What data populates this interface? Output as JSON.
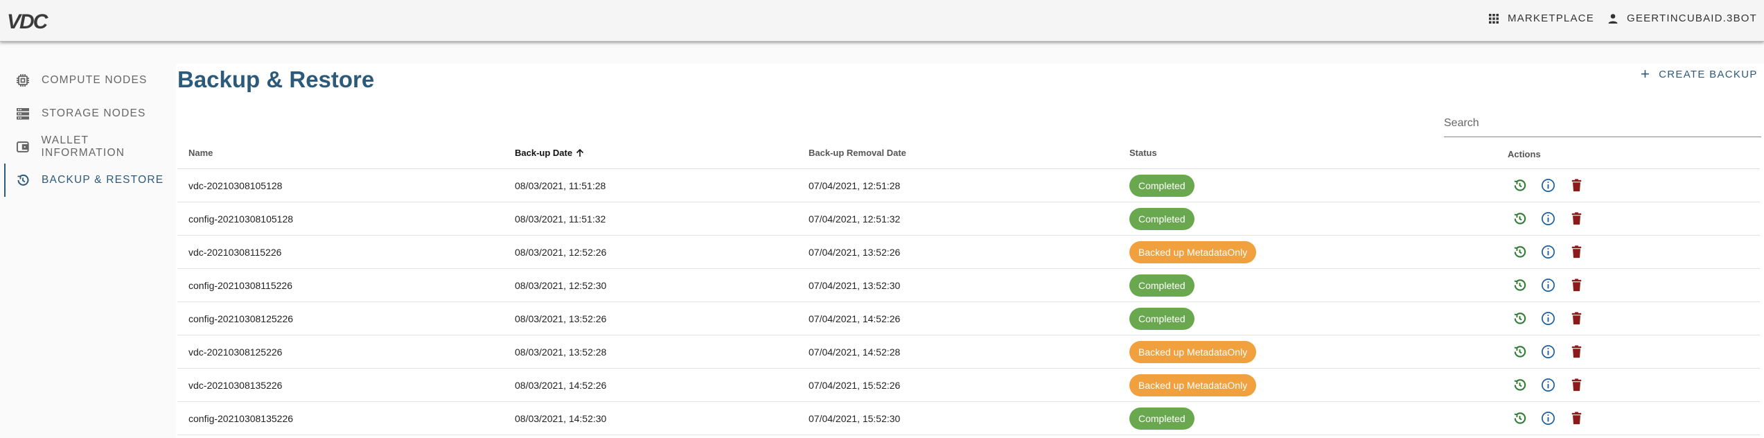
{
  "app": {
    "logo_text": "VDC"
  },
  "header": {
    "marketplace_label": "MARKETPLACE",
    "user_label": "GEERTINCUBAID.3BOT"
  },
  "sidebar": {
    "items": [
      {
        "label": "COMPUTE NODES",
        "icon": "chip-icon"
      },
      {
        "label": "STORAGE NODES",
        "icon": "storage-icon"
      },
      {
        "label": "WALLET INFORMATION",
        "icon": "wallet-icon"
      },
      {
        "label": "BACKUP & RESTORE",
        "icon": "restore-icon",
        "active": true
      }
    ]
  },
  "page": {
    "title": "Backup & Restore",
    "create_label": "CREATE BACKUP",
    "search_placeholder": "Search"
  },
  "table": {
    "headers": {
      "name": "Name",
      "backup_date": "Back-up Date",
      "removal_date": "Back-up Removal Date",
      "status": "Status",
      "actions": "Actions"
    },
    "sort": {
      "column": "backup_date",
      "direction": "ascending"
    },
    "rows": [
      {
        "name": "vdc-20210308105128",
        "backup_date": "08/03/2021, 11:51:28",
        "removal_date": "07/04/2021, 12:51:28",
        "status": "Completed",
        "status_color": "#6aa84f"
      },
      {
        "name": "config-20210308105128",
        "backup_date": "08/03/2021, 11:51:32",
        "removal_date": "07/04/2021, 12:51:32",
        "status": "Completed",
        "status_color": "#6aa84f"
      },
      {
        "name": "vdc-20210308115226",
        "backup_date": "08/03/2021, 12:52:26",
        "removal_date": "07/04/2021, 13:52:26",
        "status": "Backed up MetadataOnly",
        "status_color": "#f0a03c"
      },
      {
        "name": "config-20210308115226",
        "backup_date": "08/03/2021, 12:52:30",
        "removal_date": "07/04/2021, 13:52:30",
        "status": "Completed",
        "status_color": "#6aa84f"
      },
      {
        "name": "config-20210308125226",
        "backup_date": "08/03/2021, 13:52:26",
        "removal_date": "07/04/2021, 14:52:26",
        "status": "Completed",
        "status_color": "#6aa84f"
      },
      {
        "name": "vdc-20210308125226",
        "backup_date": "08/03/2021, 13:52:28",
        "removal_date": "07/04/2021, 14:52:28",
        "status": "Backed up MetadataOnly",
        "status_color": "#f0a03c"
      },
      {
        "name": "vdc-20210308135226",
        "backup_date": "08/03/2021, 14:52:26",
        "removal_date": "07/04/2021, 15:52:26",
        "status": "Backed up MetadataOnly",
        "status_color": "#f0a03c"
      },
      {
        "name": "config-20210308135226",
        "backup_date": "08/03/2021, 14:52:30",
        "removal_date": "07/04/2021, 15:52:30",
        "status": "Completed",
        "status_color": "#6aa84f"
      }
    ],
    "row_actions": [
      "restore-icon",
      "info-icon",
      "delete-icon"
    ]
  },
  "colors": {
    "primary": "#2b5a7b",
    "completed": "#6aa84f",
    "metadata_only": "#f0a03c",
    "restore": "#2e7d32",
    "info": "#1e5fa0",
    "delete": "#8b1a1a"
  }
}
